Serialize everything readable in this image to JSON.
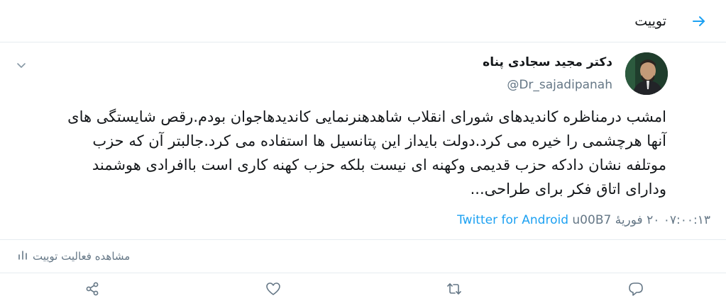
{
  "header": {
    "title": "توییت"
  },
  "tweet": {
    "author_name": "دکتر مجید سجادی پناه",
    "author_handle": "@Dr_sajadipanah",
    "lines": [
      "امشب درمناظره کاندیدهای شورای انقلاب شاهدهنرنمایی کاندیدهاجوان بودم.رقص شایستگی های",
      "آنها هرچشمی را خیره می کرد.دولت بایداز این پتانسیل ها استفاده می کرد.جالبتر آن که حزب",
      "موتلفه نشان دادکه حزب قدیمی وکهنه ای نیست بلکه حزب کهنه کاری است باافرادی هوشمند",
      "ودارای اتاق فکر برای طراحی..."
    ],
    "timestamp": "۰۷:۰۰:۱۳ ۲۰ فوریهٔ",
    "separator": "u00B7",
    "source": "Twitter for Android"
  },
  "activity": {
    "label": "مشاهده فعالیت توییت"
  },
  "icons": {
    "back": "arrow-right-icon",
    "caret": "chevron-down-icon",
    "activity": "bar-chart-icon",
    "share": "share-icon",
    "like": "heart-icon",
    "retweet": "retweet-icon",
    "reply": "reply-icon"
  },
  "colors": {
    "accent": "#1da1f2",
    "secondary": "#657786",
    "text": "#14171a",
    "border": "#e6ecf0"
  }
}
